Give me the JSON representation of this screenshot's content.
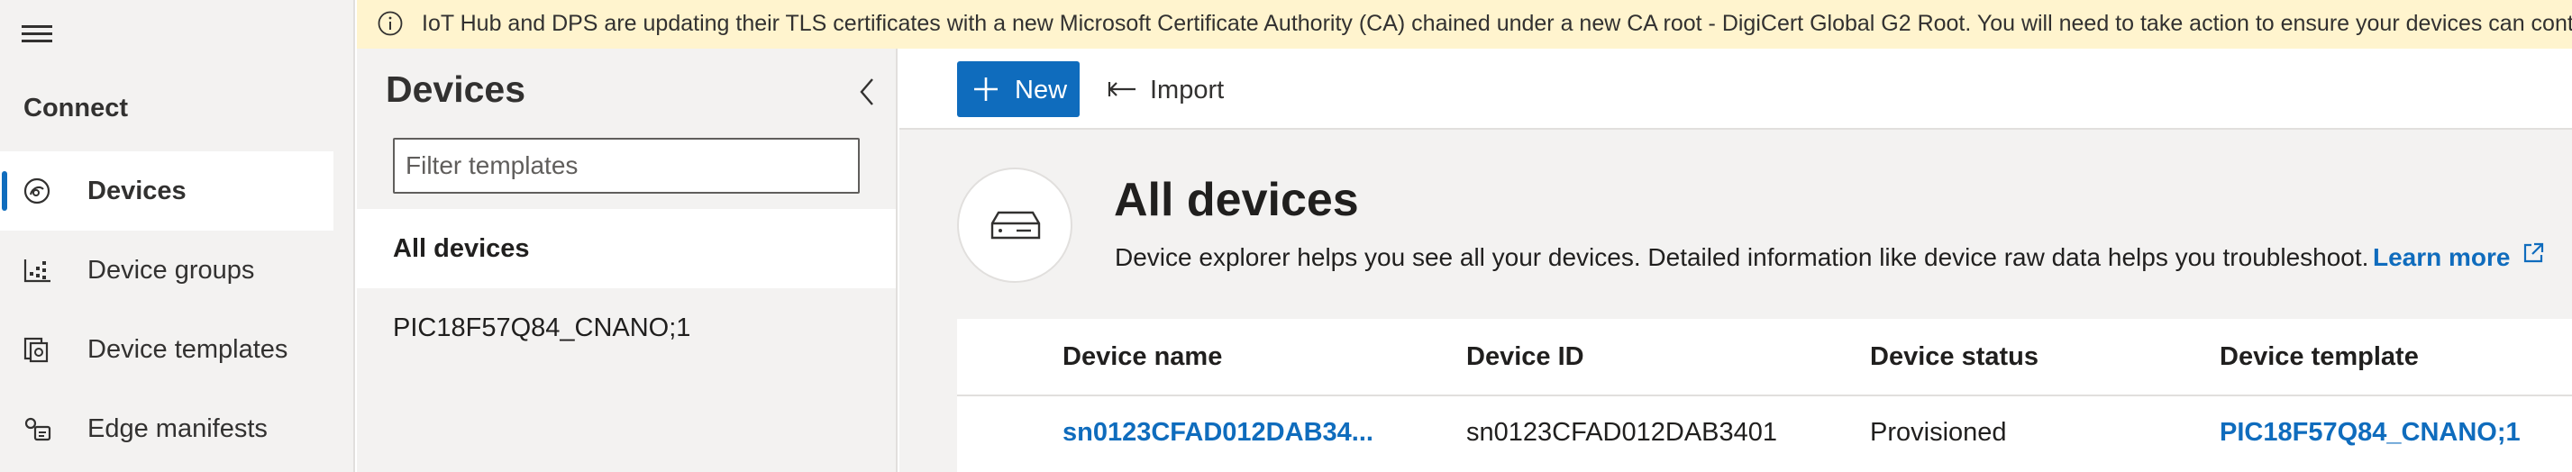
{
  "nav": {
    "menu_icon": "hamburger-icon",
    "section": "Connect",
    "items": [
      {
        "label": "Devices",
        "icon": "devices-icon",
        "selected": true
      },
      {
        "label": "Device groups",
        "icon": "device-groups-icon",
        "selected": false
      },
      {
        "label": "Device templates",
        "icon": "device-templates-icon",
        "selected": false
      },
      {
        "label": "Edge manifests",
        "icon": "edge-manifests-icon",
        "selected": false
      }
    ]
  },
  "banner": {
    "icon": "info-icon",
    "text": "IoT Hub and DPS are updating their TLS certificates with a new Microsoft Certificate Authority (CA) chained under a new CA root - DigiCert Global G2 Root. You will need to take action to ensure your devices can continue to connect."
  },
  "templates_pane": {
    "title": "Devices",
    "collapse_icon": "chevron-left-icon",
    "filter_placeholder": "Filter templates",
    "items": [
      {
        "label": "All devices",
        "selected": true
      },
      {
        "label": "PIC18F57Q84_CNANO;1",
        "selected": false
      }
    ]
  },
  "toolbar": {
    "new_label": "New",
    "import_label": "Import"
  },
  "hero": {
    "icon": "device-icon",
    "title": "All devices",
    "description": "Device explorer helps you see all your devices. Detailed information like device raw data helps you troubleshoot.",
    "learn_more": "Learn more"
  },
  "table": {
    "columns": [
      "Device name",
      "Device ID",
      "Device status",
      "Device template"
    ],
    "rows": [
      {
        "device_name": "sn0123CFAD012DAB34...",
        "device_id": "sn0123CFAD012DAB3401",
        "device_status": "Provisioned",
        "device_template": "PIC18F57Q84_CNANO;1"
      }
    ]
  },
  "colors": {
    "accent": "#0f6cbd",
    "banner_bg": "#fff4ce",
    "pane_bg": "#f3f2f1"
  }
}
